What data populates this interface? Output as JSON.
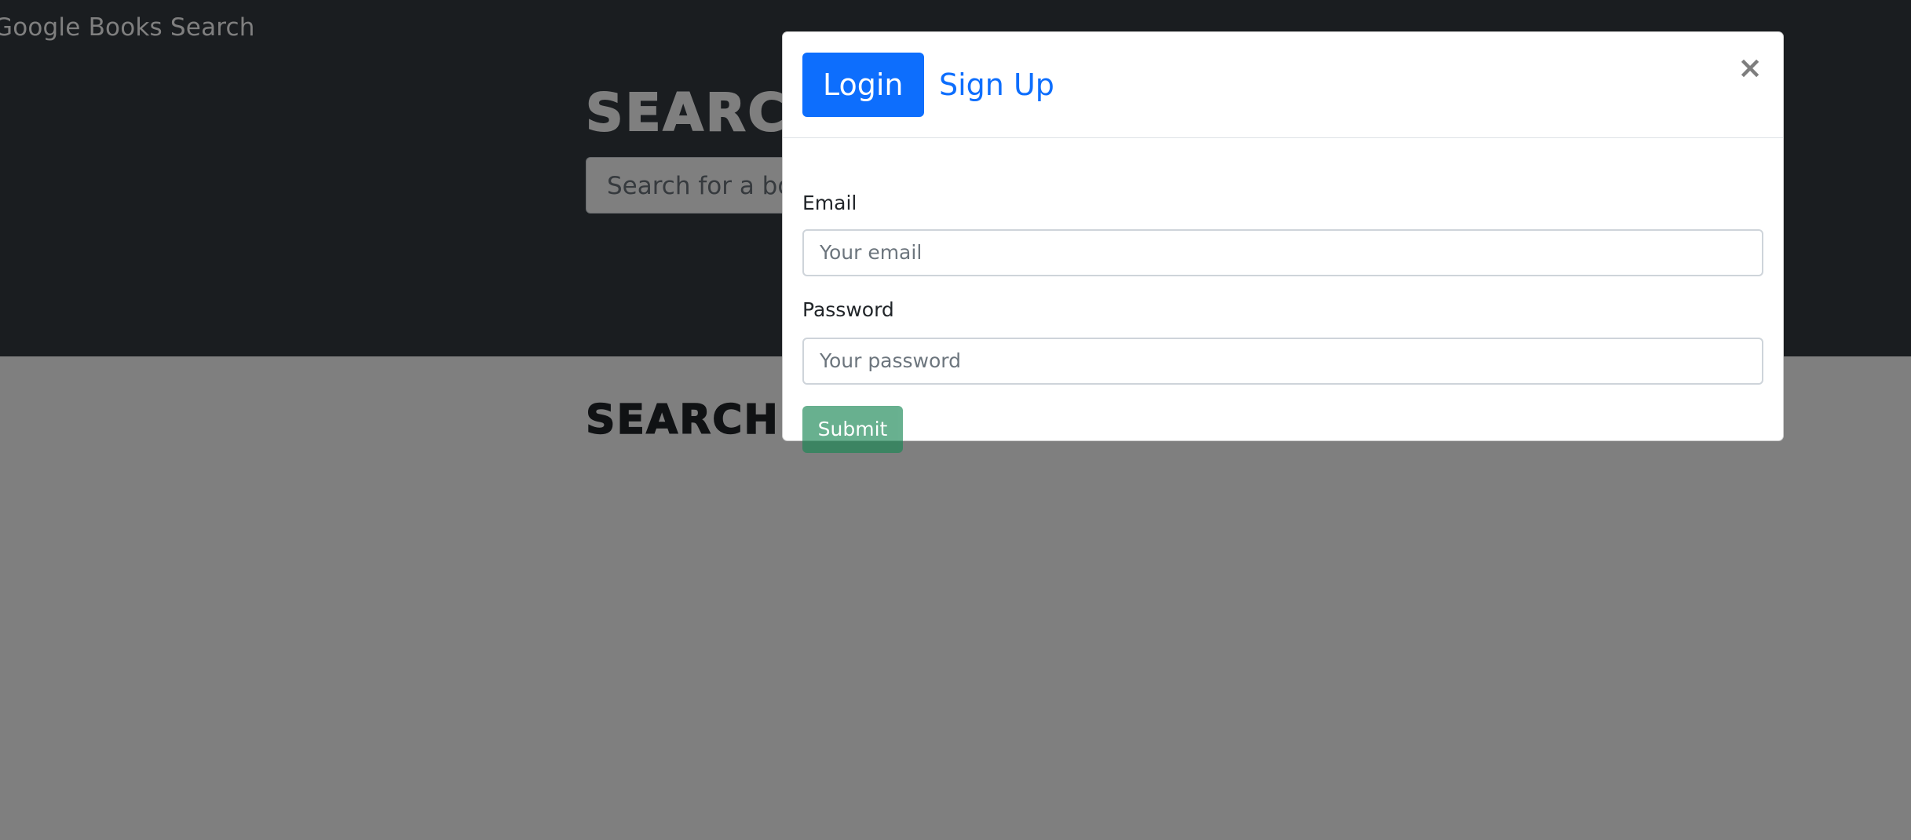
{
  "navbar": {
    "brand": "Google Books Search"
  },
  "hero": {
    "title": "SEARCH FOR BOOKS!",
    "search_placeholder": "Search for a book"
  },
  "results": {
    "title": "SEARCH FOR A BOOK TO BEGIN"
  },
  "modal": {
    "tabs": [
      {
        "label": "Login",
        "active": true
      },
      {
        "label": "Sign Up",
        "active": false
      }
    ],
    "close_label": "×",
    "form": {
      "email_label": "Email",
      "email_placeholder": "Your email",
      "password_label": "Password",
      "password_placeholder": "Your password",
      "submit_label": "Submit"
    }
  },
  "colors": {
    "navbar_bg": "#343a40",
    "primary": "#0d6efd",
    "success": "#198754"
  }
}
